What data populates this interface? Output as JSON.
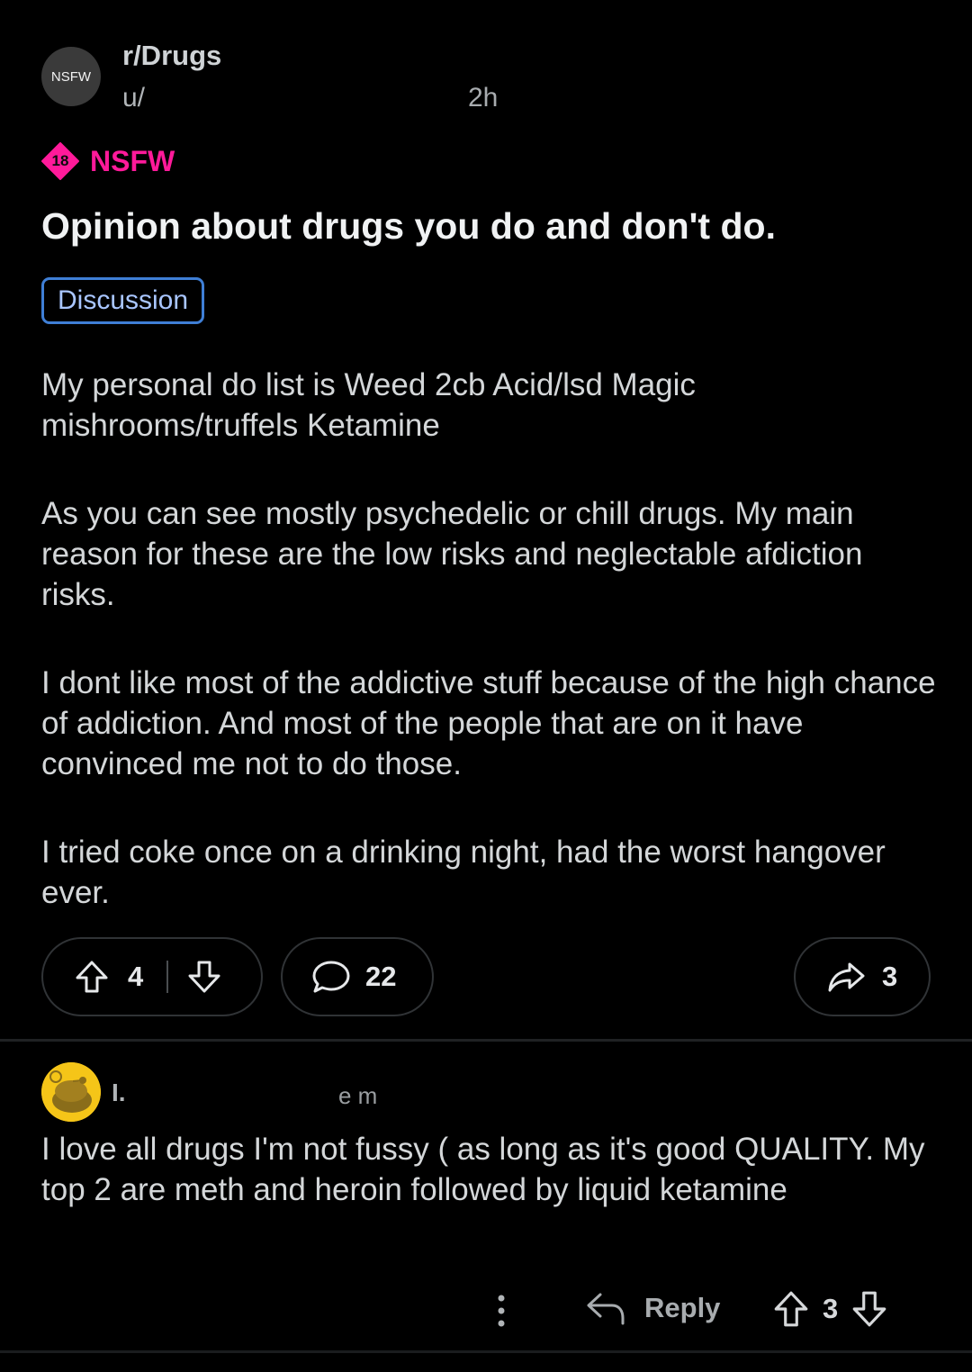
{
  "header": {
    "avatar_label": "NSFW",
    "subreddit": "r/Drugs",
    "author": "u/",
    "age": "2h"
  },
  "post": {
    "nsfw_badge": "18",
    "nsfw_label": "NSFW",
    "title": "Opinion about drugs you do and don't do.",
    "flair": "Discussion",
    "paragraphs": [
      "My personal do list is Weed 2cb Acid/lsd Magic mishrooms/truffels Ketamine",
      "As you can see mostly psychedelic or chill drugs. My main reason for these are the low risks and neglectable afdiction risks.",
      "I dont like most of the addictive stuff because of the high chance of addiction. And most of the people that are on it have convinced me not to do those.",
      "I tried coke once on a drinking night, had the worst hangover ever."
    ],
    "vote_count": "4",
    "comment_count": "22",
    "share_count": "3"
  },
  "comment": {
    "user": "I.",
    "meta": "e m",
    "text": "I love all drugs I'm not fussy ( as long as it's good QUALITY. My top 2 are meth and heroin followed by liquid ketamine",
    "reply_label": "Reply",
    "vote_count": "3"
  },
  "colors": {
    "background": "#000000",
    "nsfw_pink": "#ff1a9a",
    "flair_blue": "#3f7fd6",
    "avatar_yellow": "#f5c518"
  }
}
